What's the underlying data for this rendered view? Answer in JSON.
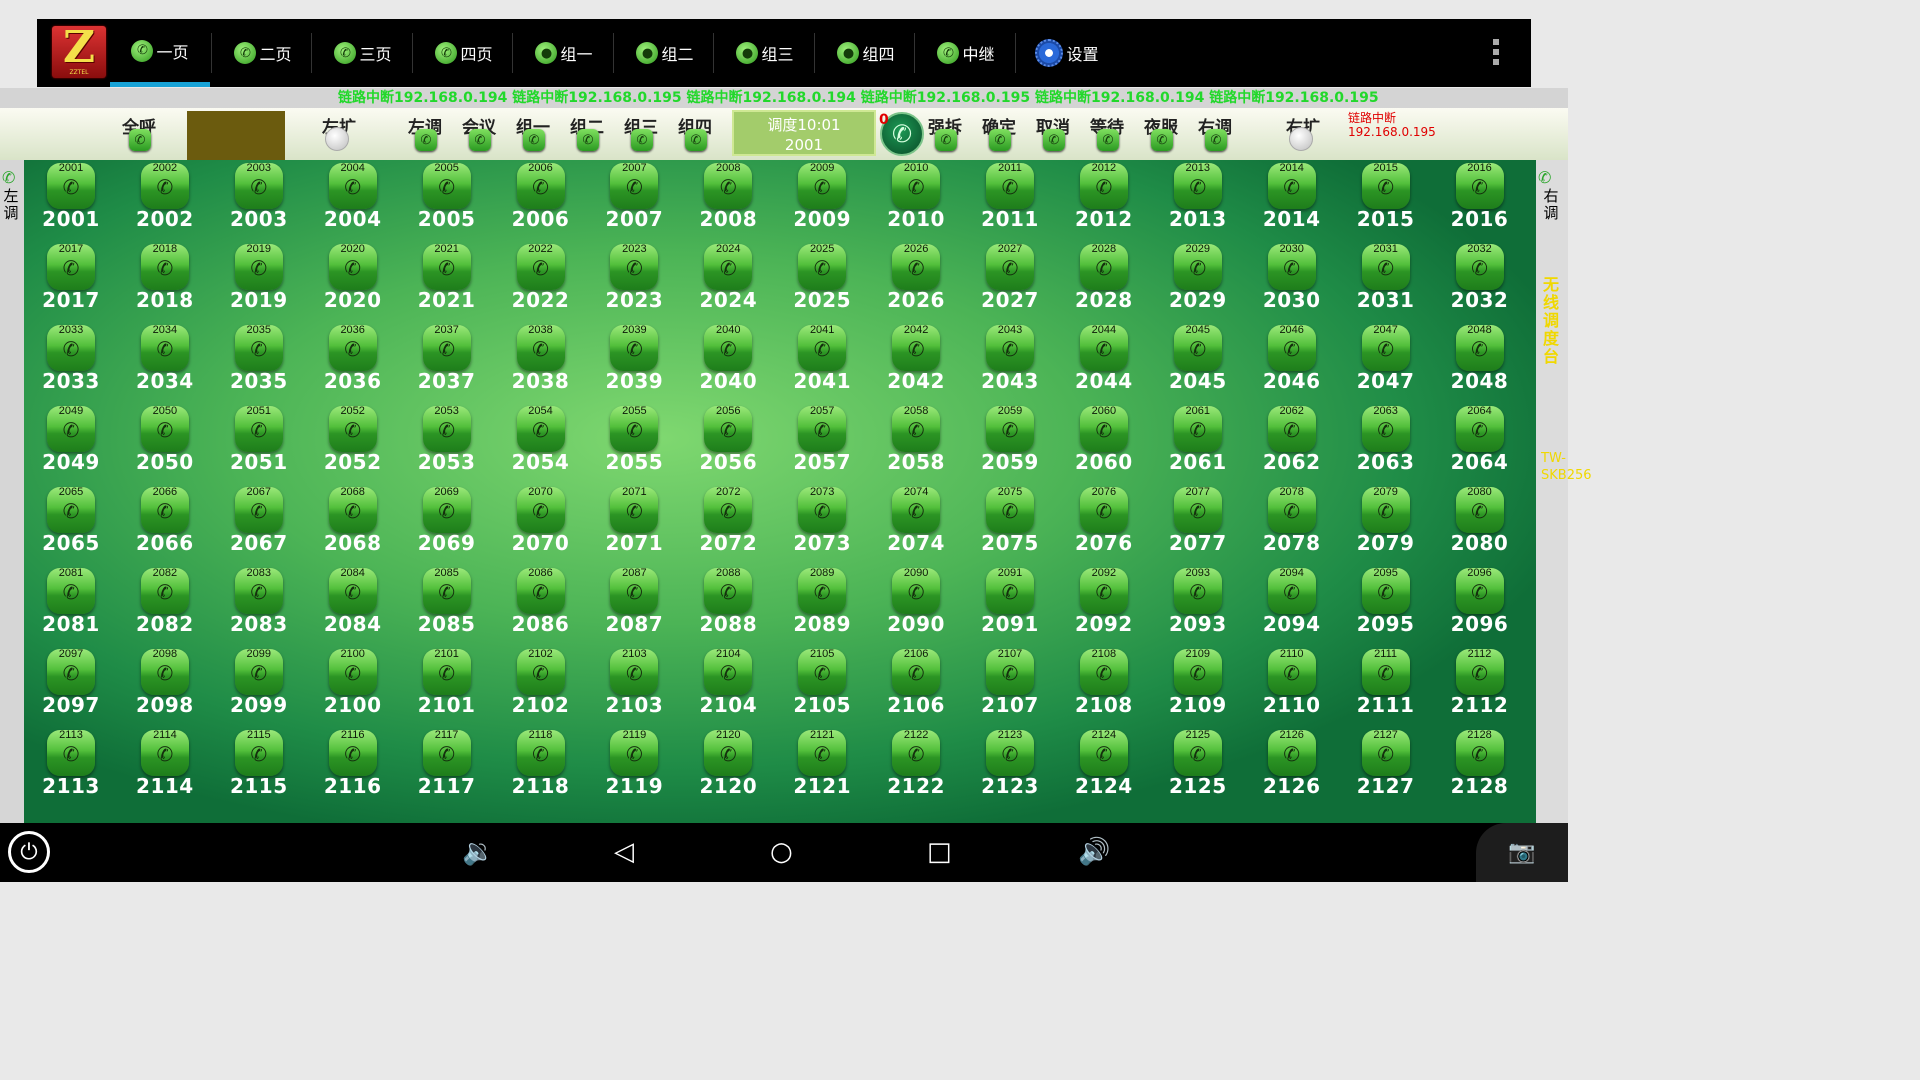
{
  "logo": {
    "letter": "Z",
    "sub": "ZZTEL"
  },
  "tabs": [
    {
      "label": "一页",
      "icon": "phone-icon",
      "active": true
    },
    {
      "label": "二页",
      "icon": "phone-icon"
    },
    {
      "label": "三页",
      "icon": "phone-icon"
    },
    {
      "label": "四页",
      "icon": "phone-icon"
    },
    {
      "label": "组一",
      "icon": "group-icon"
    },
    {
      "label": "组二",
      "icon": "group-icon"
    },
    {
      "label": "组三",
      "icon": "group-icon"
    },
    {
      "label": "组四",
      "icon": "group-icon"
    },
    {
      "label": "中继",
      "icon": "trunk-phone-icon"
    },
    {
      "label": "设置",
      "icon": "gear-icon"
    }
  ],
  "marquee": "链路中断192.168.0.194 链路中断192.168.0.195 链路中断192.168.0.194 链路中断192.168.0.195 链路中断192.168.0.194 链路中断192.168.0.195",
  "controls": {
    "all_call": "全呼",
    "left_expand": "左扩",
    "left_adjust": "左调",
    "meeting": "会议",
    "group1": "组一",
    "group2": "组二",
    "group3": "组三",
    "group4": "组四",
    "dispatch_time": "调度10:01",
    "dispatch_ext": "2001",
    "call_count": "0",
    "barge": "强拆",
    "confirm": "确定",
    "cancel": "取消",
    "wait": "等待",
    "night": "夜服",
    "right_adjust": "右调",
    "right_expand": "右扩",
    "link_status": "链路中断",
    "link_ip": "192.168.0.195"
  },
  "side": {
    "left_label": "左调",
    "right_label": "右调",
    "wireless": "无线调度台",
    "model": "TW-SKB256"
  },
  "colors": {
    "accent": "#17a2d6",
    "marquee": "#22d82b",
    "alert": "#e00000",
    "side_text": "#f0d800"
  },
  "extensions": [
    "2001",
    "2002",
    "2003",
    "2004",
    "2005",
    "2006",
    "2007",
    "2008",
    "2009",
    "2010",
    "2011",
    "2012",
    "2013",
    "2014",
    "2015",
    "2016",
    "2017",
    "2018",
    "2019",
    "2020",
    "2021",
    "2022",
    "2023",
    "2024",
    "2025",
    "2026",
    "2027",
    "2028",
    "2029",
    "2030",
    "2031",
    "2032",
    "2033",
    "2034",
    "2035",
    "2036",
    "2037",
    "2038",
    "2039",
    "2040",
    "2041",
    "2042",
    "2043",
    "2044",
    "2045",
    "2046",
    "2047",
    "2048",
    "2049",
    "2050",
    "2051",
    "2052",
    "2053",
    "2054",
    "2055",
    "2056",
    "2057",
    "2058",
    "2059",
    "2060",
    "2061",
    "2062",
    "2063",
    "2064",
    "2065",
    "2066",
    "2067",
    "2068",
    "2069",
    "2070",
    "2071",
    "2072",
    "2073",
    "2074",
    "2075",
    "2076",
    "2077",
    "2078",
    "2079",
    "2080",
    "2081",
    "2082",
    "2083",
    "2084",
    "2085",
    "2086",
    "2087",
    "2088",
    "2089",
    "2090",
    "2091",
    "2092",
    "2093",
    "2094",
    "2095",
    "2096",
    "2097",
    "2098",
    "2099",
    "2100",
    "2101",
    "2102",
    "2103",
    "2104",
    "2105",
    "2106",
    "2107",
    "2108",
    "2109",
    "2110",
    "2111",
    "2112",
    "2113",
    "2114",
    "2115",
    "2116",
    "2117",
    "2118",
    "2119",
    "2120",
    "2121",
    "2122",
    "2123",
    "2124",
    "2125",
    "2126",
    "2127",
    "2128"
  ]
}
